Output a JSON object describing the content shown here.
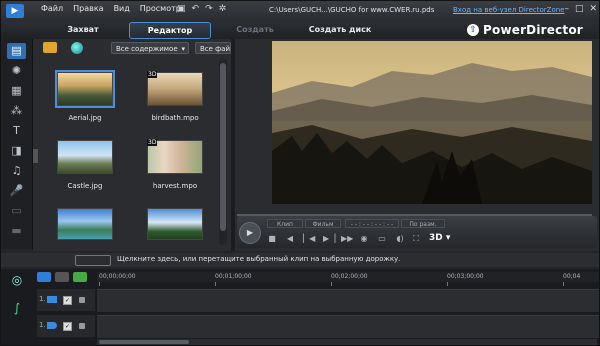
{
  "titlebar": {
    "menu": [
      "Файл",
      "Правка",
      "Вид",
      "Просмотр"
    ],
    "path": "C:\\Users\\GUCH...\\GUCHO for www.CWER.ru.pds",
    "web_link": "Вход на веб-узел DirectorZone"
  },
  "header": {
    "tabs": [
      "Захват",
      "Редактор",
      "Создать фильм",
      "Создать диск"
    ],
    "brand": "PowerDirector"
  },
  "library": {
    "filter_dropdown": "Все содержимое",
    "filter_dropdown2": "Все файлы",
    "items": [
      {
        "name": "Aerial.jpg",
        "badge": ""
      },
      {
        "name": "birdbath.mpo",
        "badge": "3D"
      },
      {
        "name": "Castle.jpg",
        "badge": ""
      },
      {
        "name": "harvest.mpo",
        "badge": "3D"
      },
      {
        "name": "",
        "badge": ""
      },
      {
        "name": "",
        "badge": ""
      }
    ]
  },
  "preview": {
    "seg_clip": "Клип",
    "seg_film": "Фильм",
    "timecode": "- - : - - : - - : - -",
    "seg_size": "По разм.",
    "badge_3d": "3D"
  },
  "hint": "Щелкните здесь, или перетащите выбранный клип на выбранную дорожку.",
  "timeline": {
    "ruler": [
      "00;00;00;00",
      "00;01;00;00",
      "00;02;00;00",
      "00;03;00;00",
      "00;04"
    ],
    "tracks": [
      "1.",
      "1."
    ]
  },
  "colors": {
    "accent": "#4a8fd8",
    "link": "#6fb6ff",
    "brand_blue": "#2f7fd8"
  }
}
